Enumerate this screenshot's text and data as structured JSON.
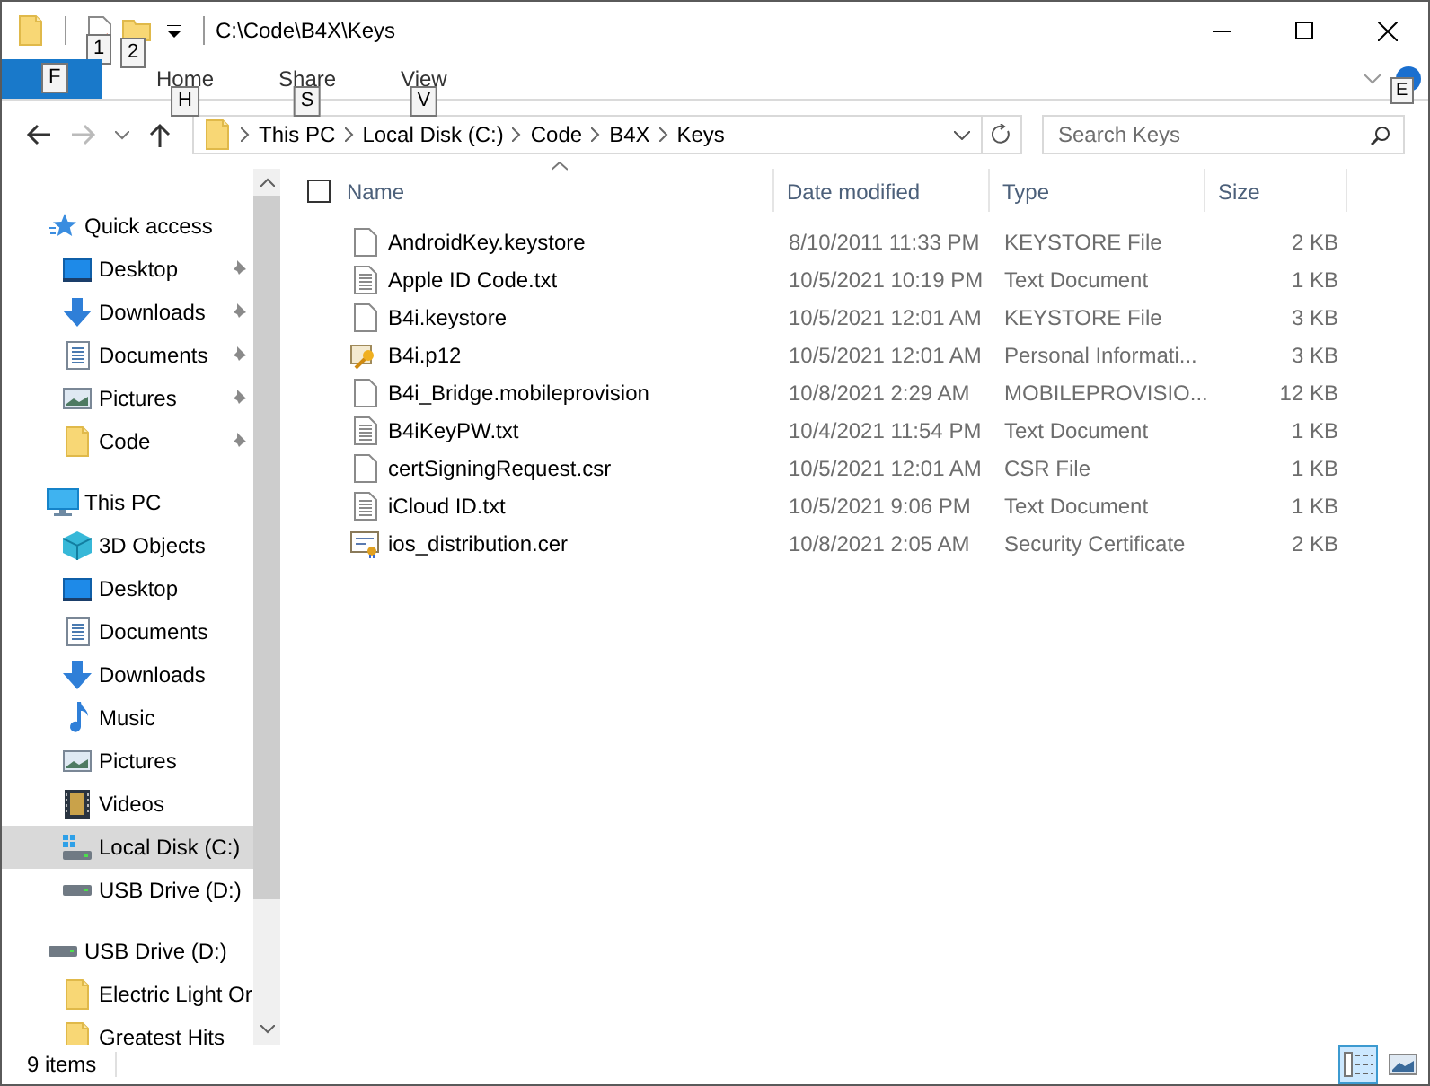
{
  "window": {
    "title": "C:\\Code\\B4X\\Keys"
  },
  "quick_access_toolbar": [
    {
      "kind": "properties",
      "keytip": "1"
    },
    {
      "kind": "new-folder",
      "keytip": "2"
    }
  ],
  "ribbon": {
    "file_keytip": "F",
    "help_keytip": "E",
    "tabs": [
      {
        "label": "Home",
        "keytip": "H",
        "selected": false
      },
      {
        "label": "Share",
        "keytip": "S",
        "selected": false
      },
      {
        "label": "View",
        "keytip": "V",
        "selected": false
      }
    ]
  },
  "address_bar": {
    "crumbs": [
      "This PC",
      "Local Disk (C:)",
      "Code",
      "B4X",
      "Keys"
    ]
  },
  "search": {
    "placeholder": "Search Keys"
  },
  "sidebar": {
    "items": [
      {
        "label": "Quick access",
        "kind": "star",
        "selected": false,
        "children": [
          {
            "label": "Desktop",
            "kind": "desktop",
            "pinned": true,
            "selected": false
          },
          {
            "label": "Downloads",
            "kind": "download",
            "pinned": true,
            "selected": false
          },
          {
            "label": "Documents",
            "kind": "documents",
            "pinned": true,
            "selected": false
          },
          {
            "label": "Pictures",
            "kind": "pictures",
            "pinned": true,
            "selected": false
          },
          {
            "label": "Code",
            "kind": "folder",
            "pinned": true,
            "selected": false
          }
        ]
      },
      {
        "label": "This PC",
        "kind": "pc",
        "selected": false,
        "children": [
          {
            "label": "3D Objects",
            "kind": "cube",
            "pinned": false,
            "selected": false
          },
          {
            "label": "Desktop",
            "kind": "desktop",
            "pinned": false,
            "selected": false
          },
          {
            "label": "Documents",
            "kind": "documents",
            "pinned": false,
            "selected": false
          },
          {
            "label": "Downloads",
            "kind": "download",
            "pinned": false,
            "selected": false
          },
          {
            "label": "Music",
            "kind": "music",
            "pinned": false,
            "selected": false
          },
          {
            "label": "Pictures",
            "kind": "pictures",
            "pinned": false,
            "selected": false
          },
          {
            "label": "Videos",
            "kind": "videos",
            "pinned": false,
            "selected": false
          },
          {
            "label": "Local Disk (C:)",
            "kind": "system-drive",
            "pinned": false,
            "selected": true
          },
          {
            "label": "USB Drive (D:)",
            "kind": "drive",
            "pinned": false,
            "selected": false
          }
        ]
      },
      {
        "label": "USB Drive (D:)",
        "kind": "drive",
        "selected": false,
        "children": [
          {
            "label": "Electric Light Or",
            "kind": "folder",
            "pinned": false,
            "selected": false
          },
          {
            "label": "Greatest Hits",
            "kind": "folder",
            "pinned": false,
            "selected": false
          }
        ]
      }
    ]
  },
  "file_list": {
    "select_all": {
      "checked": false
    },
    "columns": [
      {
        "label": "Name",
        "sorted": true
      },
      {
        "label": "Date modified",
        "sorted": false
      },
      {
        "label": "Type",
        "sorted": false
      },
      {
        "label": "Size",
        "sorted": false
      }
    ],
    "rows": [
      {
        "name": "AndroidKey.keystore",
        "date": "8/10/2011 11:33 PM",
        "type": "KEYSTORE File",
        "size": "2 KB",
        "kind": "blank"
      },
      {
        "name": "Apple ID Code.txt",
        "date": "10/5/2021 10:19 PM",
        "type": "Text Document",
        "size": "1 KB",
        "kind": "text"
      },
      {
        "name": "B4i.keystore",
        "date": "10/5/2021 12:01 AM",
        "type": "KEYSTORE File",
        "size": "3 KB",
        "kind": "blank"
      },
      {
        "name": "B4i.p12",
        "date": "10/5/2021 12:01 AM",
        "type": "Personal Informati...",
        "size": "3 KB",
        "kind": "key-cert"
      },
      {
        "name": "B4i_Bridge.mobileprovision",
        "date": "10/8/2021 2:29 AM",
        "type": "MOBILEPROVISIO...",
        "size": "12 KB",
        "kind": "blank"
      },
      {
        "name": "B4iKeyPW.txt",
        "date": "10/4/2021 11:54 PM",
        "type": "Text Document",
        "size": "1 KB",
        "kind": "text"
      },
      {
        "name": "certSigningRequest.csr",
        "date": "10/5/2021 12:01 AM",
        "type": "CSR File",
        "size": "1 KB",
        "kind": "blank"
      },
      {
        "name": "iCloud ID.txt",
        "date": "10/5/2021 9:06 PM",
        "type": "Text Document",
        "size": "1 KB",
        "kind": "text"
      },
      {
        "name": "ios_distribution.cer",
        "date": "10/8/2021 2:05 AM",
        "type": "Security Certificate",
        "size": "2 KB",
        "kind": "certificate"
      }
    ]
  },
  "status_bar": {
    "item_count": "9 items",
    "views": [
      {
        "kind": "details",
        "selected": true
      },
      {
        "kind": "large-icons",
        "selected": false
      }
    ]
  }
}
